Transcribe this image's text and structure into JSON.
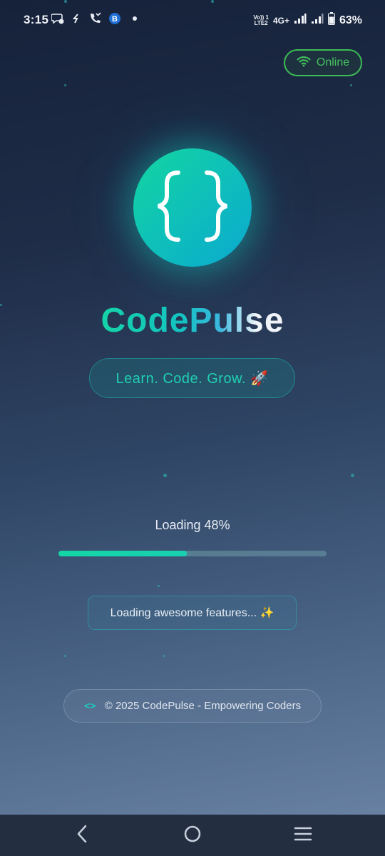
{
  "status_bar": {
    "time": "3:15",
    "volte_line1": "Vo)) 1",
    "volte_line2": "LTE2",
    "network": "4G+",
    "battery": "63%"
  },
  "connection": {
    "label": "Online",
    "color": "#46c45f"
  },
  "app": {
    "name": "CodePulse",
    "tagline": "Learn. Code. Grow. 🚀",
    "logo_icon": "curly-braces-icon"
  },
  "loading": {
    "label": "Loading 48%",
    "progress": 0.48,
    "message": "Loading awesome features... ✨"
  },
  "footer": {
    "icon": "code-brackets-icon",
    "icon_glyph": "<>",
    "text": "© 2025 CodePulse - Empowering Coders"
  },
  "nav": {
    "back": "back-icon",
    "home": "home-icon",
    "recents": "recents-icon"
  },
  "colors": {
    "accent": "#14d3a7",
    "accent_blue": "#0aa8d0"
  }
}
